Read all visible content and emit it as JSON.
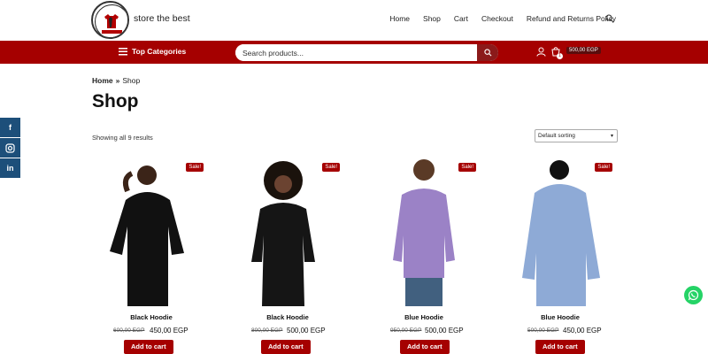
{
  "header": {
    "logo_alt": "CLOTHES STORE MAN & WOMEN",
    "tagline": "store the best",
    "nav": [
      "Home",
      "Shop",
      "Cart",
      "Checkout",
      "Refund and Returns Policy"
    ]
  },
  "redbar": {
    "top_categories": "Top Categories",
    "search_placeholder": "Search products...",
    "cart_count": "1",
    "cart_total": "500,00 EGP"
  },
  "content": {
    "breadcrumb": {
      "home": "Home",
      "sep": "»",
      "current": "Shop"
    },
    "title": "Shop",
    "result_count": "Showing all 9 results",
    "sort_selected": "Default sorting"
  },
  "products": [
    {
      "name": "Black Hoodie",
      "old_price": "600,00 EGP",
      "new_price": "450,00 EGP",
      "badge": "Sale!",
      "button": "Add to cart",
      "color": "#111111"
    },
    {
      "name": "Black Hoodie",
      "old_price": "800,00 EGP",
      "new_price": "500,00 EGP",
      "badge": "Sale!",
      "button": "Add to cart",
      "color": "#151515"
    },
    {
      "name": "Blue Hoodie",
      "old_price": "950,00 EGP",
      "new_price": "500,00 EGP",
      "badge": "Sale!",
      "button": "Add to cart",
      "color": "#9b82c6"
    },
    {
      "name": "Blue Hoodie",
      "old_price": "500,00 EGP",
      "new_price": "450,00 EGP",
      "badge": "Sale!",
      "button": "Add to cart",
      "color": "#8eaad6"
    }
  ],
  "colors": {
    "brand_red": "#a50000",
    "social_blue": "#1d4f7a",
    "whatsapp": "#25d366"
  }
}
